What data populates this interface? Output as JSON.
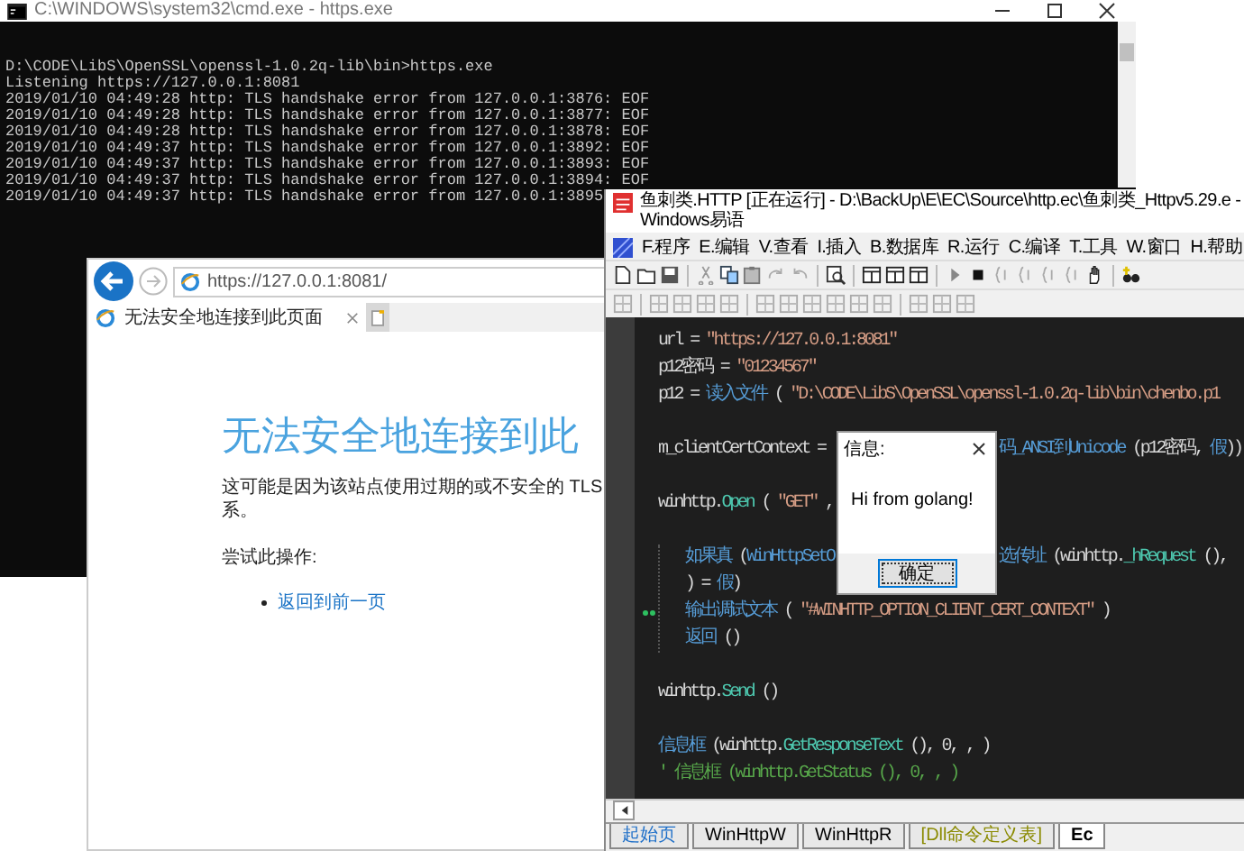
{
  "console": {
    "title": "C:\\WINDOWS\\system32\\cmd.exe - https.exe",
    "lines": [
      "D:\\CODE\\LibS\\OpenSSL\\openssl-1.0.2q-lib\\bin>https.exe",
      "Listening https://127.0.0.1:8081",
      "2019/01/10 04:49:28 http: TLS handshake error from 127.0.0.1:3876: EOF",
      "2019/01/10 04:49:28 http: TLS handshake error from 127.0.0.1:3877: EOF",
      "2019/01/10 04:49:28 http: TLS handshake error from 127.0.0.1:3878: EOF",
      "2019/01/10 04:49:37 http: TLS handshake error from 127.0.0.1:3892: EOF",
      "2019/01/10 04:49:37 http: TLS handshake error from 127.0.0.1:3893: EOF",
      "2019/01/10 04:49:37 http: TLS handshake error from 127.0.0.1:3894: EOF",
      "2019/01/10 04:49:37 http: TLS handshake error from 127.0.0.1:3895"
    ]
  },
  "browser": {
    "url": "https://127.0.0.1:8081/",
    "tabs": [
      {
        "title": "无法安全地连接到此页面",
        "selected": true
      }
    ],
    "heading": "无法安全地连接到此",
    "paragraph": [
      "这可能是因为该站点使用过期的或不安全的 TLS",
      "系。"
    ],
    "try_label": "尝试此操作:",
    "links": [
      "返回到前一页"
    ]
  },
  "ide": {
    "title": "鱼刺类.HTTP [正在运行] - D:\\BackUp\\E\\EC\\Source\\http.ec\\鱼刺类_Httpv5.29.e - Windows易语",
    "menu": [
      "F.程序",
      "E.编辑",
      "V.查看",
      "I.插入",
      "B.数据库",
      "R.运行",
      "C.编译",
      "T.工具",
      "W.窗口",
      "H.帮助"
    ],
    "code": [
      {
        "kind": "line",
        "tokens": [
          {
            "kind": "plain",
            "text": "url = "
          },
          {
            "kind": "string",
            "text": "\"https://127.0.0.1:8081\""
          }
        ]
      },
      {
        "kind": "line",
        "tokens": [
          {
            "kind": "plain",
            "text": "p12密码 = "
          },
          {
            "kind": "string",
            "text": "\"01234567\""
          }
        ]
      },
      {
        "kind": "line",
        "tokens": [
          {
            "kind": "plain",
            "text": "p12 = "
          },
          {
            "kind": "func",
            "text": "读入文件"
          },
          {
            "kind": "plain",
            "text": " ( "
          },
          {
            "kind": "string",
            "text": "\"D:\\CODE\\LibS\\OpenSSL\\openssl-1.0.2q-lib\\bin\\chenbo.p1"
          }
        ]
      },
      {
        "kind": "blank"
      },
      {
        "kind": "line",
        "tokens": [
          {
            "kind": "plain",
            "text": "m_clientCertContext ="
          }
        ],
        "after_dialog": [
          {
            "kind": "func",
            "text": "码_ANSI到Unicode"
          },
          {
            "kind": "plain",
            "text": " (p12密码, "
          },
          {
            "kind": "func",
            "text": "假"
          },
          {
            "kind": "plain",
            "text": "))"
          }
        ]
      },
      {
        "kind": "blank"
      },
      {
        "kind": "line",
        "tokens": [
          {
            "kind": "plain",
            "text": "winhttp."
          },
          {
            "kind": "method",
            "text": "Open"
          },
          {
            "kind": "plain",
            "text": " ( "
          },
          {
            "kind": "string",
            "text": "\"GET\""
          },
          {
            "kind": "plain",
            "text": " ,"
          }
        ]
      },
      {
        "kind": "blank"
      },
      {
        "kind": "block",
        "children": [
          {
            "kind": "line",
            "current": false,
            "tokens": [
              {
                "kind": "func",
                "text": "如果真"
              },
              {
                "kind": "plain",
                "text": " ("
              },
              {
                "kind": "func",
                "text": "WinHttpSetO"
              }
            ],
            "after_dialog": [
              {
                "kind": "func",
                "text": "选传址"
              },
              {
                "kind": "plain",
                "text": " (winhttp."
              },
              {
                "kind": "method",
                "text": "_hRequest"
              },
              {
                "kind": "plain",
                "text": " (),"
              }
            ]
          },
          {
            "kind": "line",
            "current": false,
            "tokens": [
              {
                "kind": "plain",
                "text": ") = "
              },
              {
                "kind": "func",
                "text": "假"
              },
              {
                "kind": "plain",
                "text": ")"
              }
            ]
          },
          {
            "kind": "line",
            "current": true,
            "tokens": [
              {
                "kind": "func",
                "text": "输出调试文本"
              },
              {
                "kind": "plain",
                "text": " ( "
              },
              {
                "kind": "string",
                "text": "\"#WINHTTP_OPTION_CLIENT_CERT_CONTEXT\""
              },
              {
                "kind": "plain",
                "text": " )"
              }
            ]
          },
          {
            "kind": "line",
            "current": false,
            "tokens": [
              {
                "kind": "func",
                "text": "返回"
              },
              {
                "kind": "plain",
                "text": " ()"
              }
            ]
          }
        ]
      },
      {
        "kind": "blank"
      },
      {
        "kind": "line",
        "tokens": [
          {
            "kind": "plain",
            "text": "winhttp."
          },
          {
            "kind": "method",
            "text": "Send"
          },
          {
            "kind": "plain",
            "text": " ()"
          }
        ]
      },
      {
        "kind": "blank"
      },
      {
        "kind": "line",
        "tokens": [
          {
            "kind": "func",
            "text": "信息框"
          },
          {
            "kind": "plain",
            "text": " (winhttp."
          },
          {
            "kind": "method",
            "text": "GetResponseText"
          },
          {
            "kind": "plain",
            "text": " (), 0, , )"
          }
        ]
      },
      {
        "kind": "line",
        "tokens": [
          {
            "kind": "comment",
            "text": "' 信息框 (winhttp.GetStatus (), 0, , )"
          }
        ]
      }
    ],
    "tabs": [
      {
        "label": "起始页",
        "selected": false,
        "color": "#1e6fc8"
      },
      {
        "label": "WinHttpW",
        "selected": false,
        "color": "#000000"
      },
      {
        "label": "WinHttpR",
        "selected": false,
        "color": "#000000"
      },
      {
        "label": "[Dll命令定义表]",
        "selected": false,
        "color": "#8a8a00"
      },
      {
        "label": "Ec",
        "selected": true,
        "color": "#000000"
      }
    ]
  },
  "dialog": {
    "title": "信息:",
    "message": "Hi from golang!",
    "button": "确定"
  }
}
